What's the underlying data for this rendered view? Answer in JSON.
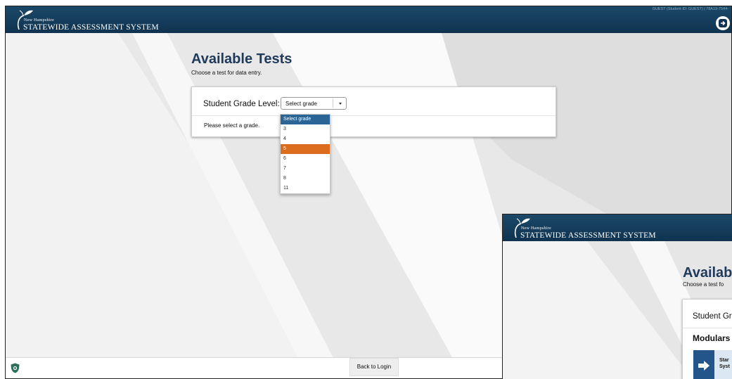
{
  "main": {
    "brand": {
      "small": "New Hampshire",
      "big": "STATEWIDE ASSESSMENT SYSTEM"
    },
    "guest_info": "GUEST (Student ID: GUEST) | 78A19-7544-",
    "page_title": "Available Tests",
    "page_subtitle": "Choose a test for data entry.",
    "grade_label": "Student Grade Level:",
    "grade_select": {
      "value": "Select grade"
    },
    "message": "Please select a grade.",
    "dropdown_options": [
      "Select grade",
      "3",
      "4",
      "5",
      "6",
      "7",
      "8",
      "11"
    ],
    "dropdown_highlighted": "5",
    "footer": {
      "back_label": "Back to Login"
    },
    "colors": {
      "header": "#14395a",
      "title": "#1f3a5b",
      "highlight": "#dc6c1e",
      "option_header": "#2a6596"
    }
  },
  "second_window": {
    "brand": {
      "small": "New Hampshire",
      "big": "STATEWIDE ASSESSMENT SYSTEM"
    },
    "page_title": "Availabl",
    "page_subtitle": "Choose a test fo",
    "grade_label": "Student Gr",
    "section_title": "Modulars",
    "start_line1": "Star",
    "start_line2": "Syst"
  }
}
